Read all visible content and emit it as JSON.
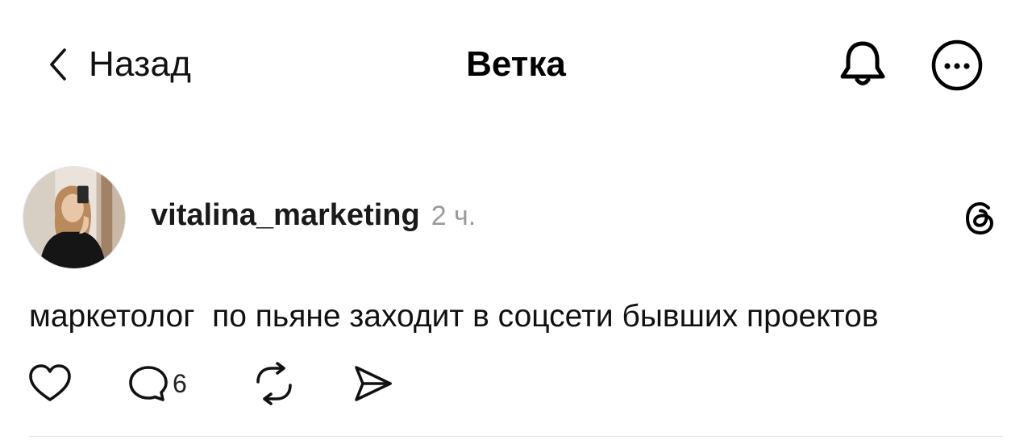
{
  "header": {
    "back_label": "Назад",
    "title": "Ветка"
  },
  "post": {
    "author": "vitalina_marketing",
    "time": "2 ч.",
    "text": "маркетолог  по пьяне заходит в соцсети бывших проектов",
    "reply_count": "6"
  },
  "icons": {
    "back": "chevron-left-icon",
    "bell": "bell-icon",
    "more": "more-icon",
    "threads": "threads-logo-icon",
    "like": "heart-icon",
    "reply": "comment-icon",
    "repost": "repost-icon",
    "share": "send-icon"
  },
  "colors": {
    "text": "#000000",
    "muted": "#9a9a9a",
    "divider": "#e2e2e2"
  }
}
